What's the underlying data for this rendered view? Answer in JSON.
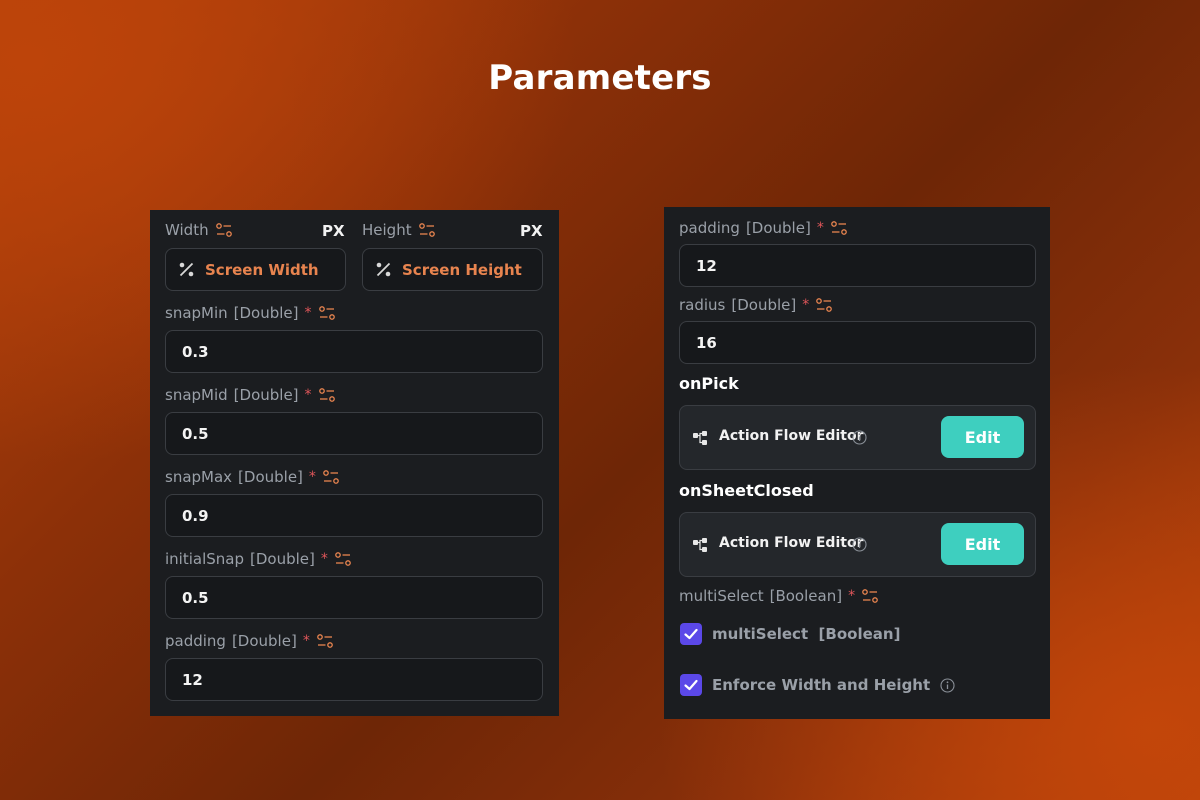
{
  "page": {
    "title": "Parameters"
  },
  "left_panel": {
    "width_label": "Width",
    "width_unit": "PX",
    "height_label": "Height",
    "height_unit": "PX",
    "width_value": "Screen Width",
    "height_value": "Screen Height",
    "params": [
      {
        "name": "snapMin",
        "type": "[Double]",
        "required": "*",
        "value": "0.3"
      },
      {
        "name": "snapMid",
        "type": "[Double]",
        "required": "*",
        "value": "0.5"
      },
      {
        "name": "snapMax",
        "type": "[Double]",
        "required": "*",
        "value": "0.9"
      },
      {
        "name": "initialSnap",
        "type": "[Double]",
        "required": "*",
        "value": "0.5"
      },
      {
        "name": "padding",
        "type": "[Double]",
        "required": "*",
        "value": "12"
      }
    ]
  },
  "right_panel": {
    "params": [
      {
        "name": "padding",
        "type": "[Double]",
        "required": "*",
        "value": "12"
      },
      {
        "name": "radius",
        "type": "[Double]",
        "required": "*",
        "value": "16"
      }
    ],
    "actions": [
      {
        "title": "onPick",
        "editor_label": "Action Flow Editor",
        "button": "Edit"
      },
      {
        "title": "onSheetClosed",
        "editor_label": "Action Flow Editor",
        "button": "Edit"
      }
    ],
    "multiselect": {
      "name": "multiSelect",
      "type": "[Boolean]",
      "required": "*"
    },
    "checkboxes": [
      {
        "label": "multiSelect  [Boolean]",
        "checked": true
      },
      {
        "label": "Enforce Width and Height",
        "checked": true
      }
    ]
  },
  "colors": {
    "accent_orange": "#e8844f",
    "edit_button": "#3ecfbf",
    "checkbox": "#5b48e8",
    "required": "#e0565a"
  },
  "icons": {
    "tune": "tune-sliders-icon",
    "percent": "percent-icon",
    "flow": "action-flow-icon",
    "info": "info-icon",
    "check": "checkmark-icon"
  }
}
